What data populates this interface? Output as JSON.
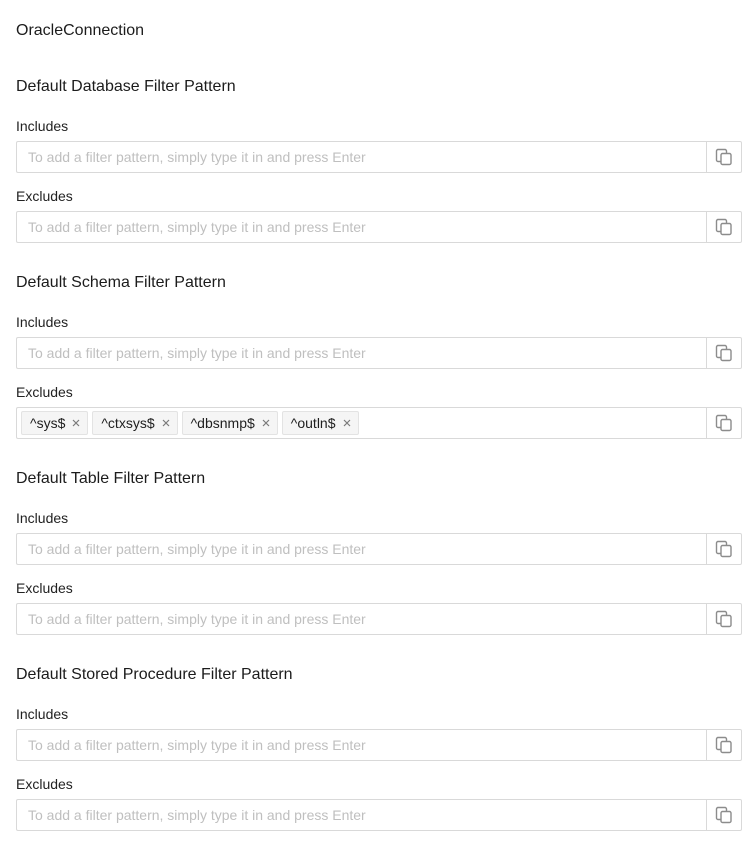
{
  "connection_title": "OracleConnection",
  "placeholder": "To add a filter pattern, simply type it in and press Enter",
  "icons": {
    "copy": "copy-icon",
    "remove_tag": "close-icon"
  },
  "sections": [
    {
      "title": "Default Database Filter Pattern",
      "includes_label": "Includes",
      "excludes_label": "Excludes",
      "includes": [],
      "excludes": []
    },
    {
      "title": "Default Schema Filter Pattern",
      "includes_label": "Includes",
      "excludes_label": "Excludes",
      "includes": [],
      "excludes": [
        "^sys$",
        "^ctxsys$",
        "^dbsnmp$",
        "^outln$"
      ]
    },
    {
      "title": "Default Table Filter Pattern",
      "includes_label": "Includes",
      "excludes_label": "Excludes",
      "includes": [],
      "excludes": []
    },
    {
      "title": "Default Stored Procedure Filter Pattern",
      "includes_label": "Includes",
      "excludes_label": "Excludes",
      "includes": [],
      "excludes": []
    }
  ]
}
